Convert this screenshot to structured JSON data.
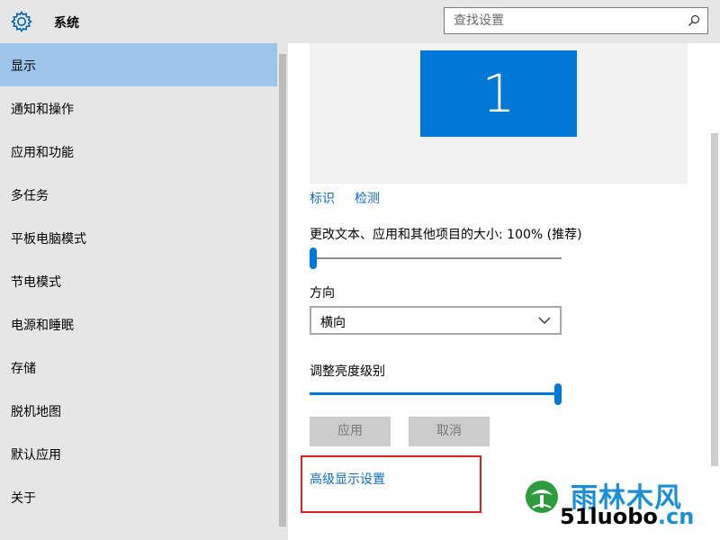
{
  "header": {
    "title": "系统",
    "search_placeholder": "查找设置",
    "gear_icon": "gear-icon",
    "search_icon": "search-icon"
  },
  "sidebar": {
    "items": [
      {
        "label": "显示",
        "active": true
      },
      {
        "label": "通知和操作"
      },
      {
        "label": "应用和功能"
      },
      {
        "label": "多任务"
      },
      {
        "label": "平板电脑模式"
      },
      {
        "label": "节电模式"
      },
      {
        "label": "电源和睡眠"
      },
      {
        "label": "存储"
      },
      {
        "label": "脱机地图"
      },
      {
        "label": "默认应用"
      },
      {
        "label": "关于"
      }
    ]
  },
  "main": {
    "monitor_number": "1",
    "identify_link": "标识",
    "detect_link": "检测",
    "scale_label": "更改文本、应用和其他项目的大小: 100% (推荐)",
    "scale_slider_value": 0,
    "orientation_label": "方向",
    "orientation_value": "横向",
    "brightness_label": "调整亮度级别",
    "brightness_slider_value": 100,
    "apply_button": "应用",
    "cancel_button": "取消",
    "advanced_link": "高级显示设置"
  },
  "watermark": {
    "text_cn": "雨林木风",
    "text_domain": "51luobo",
    "text_tld": ".cn"
  },
  "colors": {
    "accent": "#0078d7",
    "active_nav": "#9dc4ea",
    "link": "#0b6bbf",
    "highlight": "#e02020"
  }
}
